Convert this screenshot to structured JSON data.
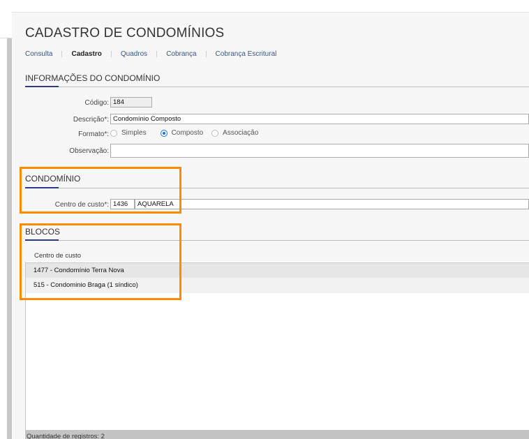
{
  "page": {
    "title": "CADASTRO DE CONDOMÍNIOS"
  },
  "tabs": [
    {
      "label": "Consulta",
      "active": false
    },
    {
      "label": "Cadastro",
      "active": true
    },
    {
      "label": "Quadros",
      "active": false
    },
    {
      "label": "Cobrança",
      "active": false
    },
    {
      "label": "Cobrança Escritural",
      "active": false
    }
  ],
  "info_section": {
    "title": "INFORMAÇÕES DO CONDOMÍNIO",
    "codigo_label": "Código:",
    "codigo_value": "184",
    "descricao_label": "Descrição*:",
    "descricao_value": "Condomínio Composto",
    "formato_label": "Formato*:",
    "formato_options": [
      "Simples",
      "Composto",
      "Associação"
    ],
    "formato_selected": "Composto",
    "observacao_label": "Observação:",
    "observacao_value": ""
  },
  "condominio_section": {
    "title": "CONDOMÍNIO",
    "centro_label": "Centro de custo*:",
    "centro_code": "1436",
    "centro_name": "AQUARELA"
  },
  "blocos_section": {
    "title": "BLOCOS",
    "column_header": "Centro de custo",
    "rows": [
      "1477 - Condomínio Terra Nova",
      "515 - Condominio Braga (1 síndico)"
    ],
    "footer": "Quantidade de registros: 2"
  },
  "colors": {
    "accent_underline": "#2b3a8a",
    "highlight_border": "#ff8c00",
    "radio_selected": "#1a73e8"
  }
}
